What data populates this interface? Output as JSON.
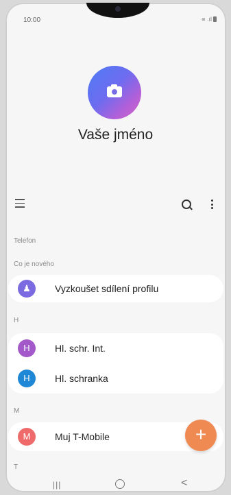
{
  "status_bar": {
    "time": "10:00",
    "signal_text": "≡ .ıl"
  },
  "profile": {
    "name": "Vaše jméno",
    "avatar_icon": "camera-icon"
  },
  "toolbar": {
    "menu_icon": "hamburger-icon",
    "search_icon": "search-icon",
    "more_icon": "more-vert-icon"
  },
  "sections": {
    "phone": "Telefon",
    "whats_new": "Co je nového",
    "h": "H",
    "m": "M",
    "t": "T"
  },
  "whats_new_item": {
    "label": "Vyzkoušet sdílení profilu",
    "avatar_icon": "people-icon",
    "color": "#7b6be0"
  },
  "contacts_h": [
    {
      "initial": "H",
      "name": "Hl. schr. Int.",
      "color": "#a359c9"
    },
    {
      "initial": "H",
      "name": "Hl. schranka",
      "color": "#1e88d6"
    }
  ],
  "contacts_m": [
    {
      "initial": "M",
      "name": "Muj T-Mobile",
      "color": "#ef6b6b"
    }
  ],
  "fab": {
    "label": "+",
    "color": "#f08a53"
  },
  "nav": {
    "recent": "|||",
    "back": "<"
  }
}
